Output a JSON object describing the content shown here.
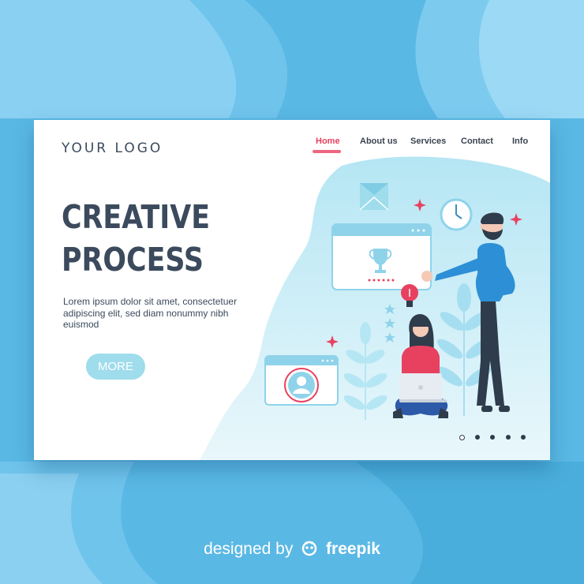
{
  "logo": "YOUR LOGO",
  "nav": {
    "items": [
      {
        "label": "Home",
        "active": true
      },
      {
        "label": "About us",
        "active": false
      },
      {
        "label": "Services",
        "active": false
      },
      {
        "label": "Contact",
        "active": false
      },
      {
        "label": "Info",
        "active": false
      }
    ]
  },
  "hero": {
    "title_line1": "CREATIVE",
    "title_line2": "PROCESS",
    "body": "Lorem ipsum dolor sit amet, consectetuer adipiscing elit, sed diam nonummy nibh euismod",
    "button_label": "MORE"
  },
  "pagination": {
    "total": 5,
    "active_index": 0
  },
  "footer": {
    "credit_prefix": "designed by",
    "credit_brand": "freepik"
  },
  "colors": {
    "background": "#5ab8e4",
    "card": "#ffffff",
    "heading": "#3b4a5c",
    "accent_pink": "#e8415f",
    "button": "#9fdcec",
    "illustration_blue": "#8fd3ea"
  },
  "icons": [
    "envelope-icon",
    "clock-icon",
    "trophy-icon",
    "lightbulb-icon",
    "user-avatar-icon",
    "star-icon",
    "sparkle-icon",
    "leaf-icon"
  ]
}
